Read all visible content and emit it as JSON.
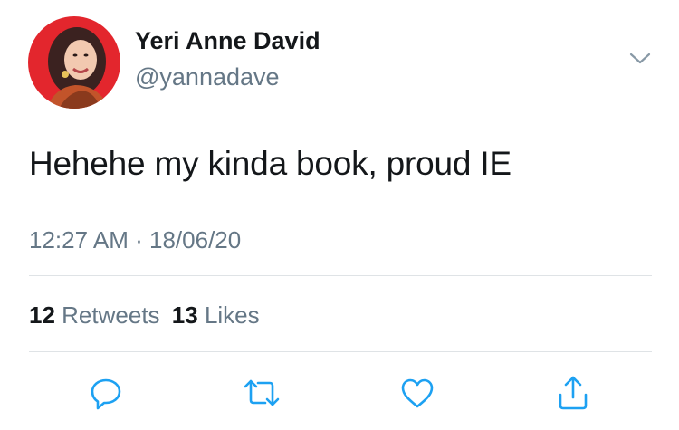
{
  "author": {
    "name": "Yeri Anne David",
    "handle": "@yannadave"
  },
  "tweet": {
    "text": "Hehehe my kinda book, proud IE",
    "time": "12:27 AM",
    "separator": "·",
    "date": "18/06/20"
  },
  "stats": {
    "retweets_count": "12",
    "retweets_label": "Retweets",
    "likes_count": "13",
    "likes_label": "Likes"
  },
  "icons": {
    "menu": "chevron-down-icon",
    "reply": "reply-icon",
    "retweet": "retweet-icon",
    "like": "heart-icon",
    "share": "share-icon"
  },
  "colors": {
    "text": "#14171a",
    "secondary": "#657786",
    "icon": "#1da1f2",
    "divider": "#dfe3e6",
    "avatar_bg": "#e3262d"
  }
}
